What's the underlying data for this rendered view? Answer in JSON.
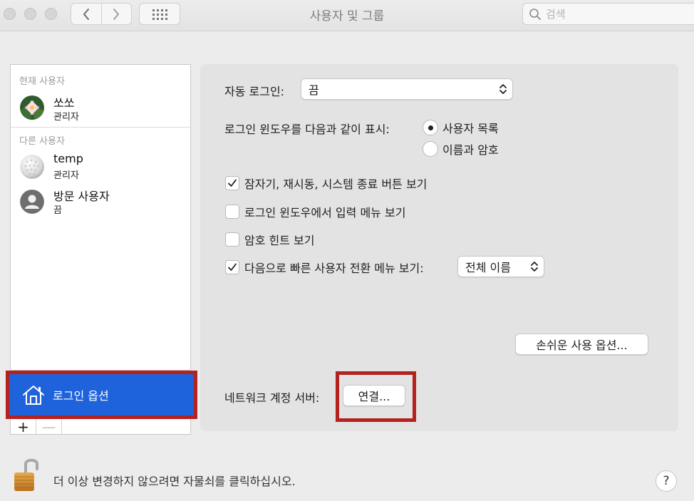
{
  "window": {
    "title": "사용자 및 그룹"
  },
  "toolbar": {
    "back_icon": "chevron-left-icon",
    "forward_icon": "chevron-right-icon",
    "show_all_icon": "grid-icon",
    "search_placeholder": "검색"
  },
  "sidebar": {
    "current_users_heading": "현재 사용자",
    "other_users_heading": "다른 사용자",
    "current_user": {
      "name": "쏘쏘",
      "role": "관리자",
      "avatar": "lotus-flower-avatar"
    },
    "other_users": [
      {
        "name": "temp",
        "role": "관리자",
        "avatar": "golf-ball-avatar"
      },
      {
        "name": "방문 사용자",
        "role": "끔",
        "avatar": "person-silhouette-avatar"
      }
    ],
    "login_options_label": "로그인 옵션",
    "add_label": "+",
    "remove_label": "—"
  },
  "panel": {
    "auto_login_label": "자동 로그인:",
    "auto_login_value": "끔",
    "display_login_label": "로그인 윈도우를 다음과 같이 표시:",
    "display_options": [
      {
        "label": "사용자 목록",
        "selected": true
      },
      {
        "label": "이름과 암호",
        "selected": false
      }
    ],
    "checkboxes": [
      {
        "label": "잠자기, 재시동, 시스템 종료 버튼 보기",
        "checked": true
      },
      {
        "label": "로그인 윈도우에서 입력 메뉴 보기",
        "checked": false
      },
      {
        "label": "암호 힌트 보기",
        "checked": false
      },
      {
        "label": "다음으로 빠른 사용자 전환 메뉴 보기:",
        "checked": true
      }
    ],
    "fast_switch_value": "전체 이름",
    "accessibility_button": "손쉬운 사용 옵션...",
    "network_server_label": "네트워크 계정 서버:",
    "connect_button": "연결..."
  },
  "footer": {
    "lock_text": "더 이상 변경하지 않으려면 자물쇠를 클릭하십시오.",
    "help_label": "?"
  },
  "colors": {
    "selection_blue": "#1f63dc",
    "highlight_red": "#b3221f"
  }
}
